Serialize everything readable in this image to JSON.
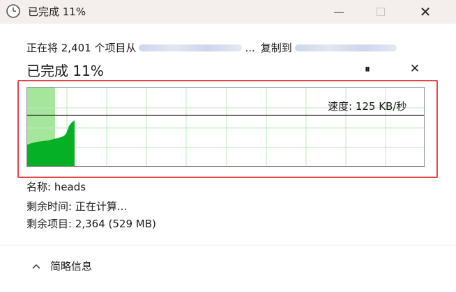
{
  "window": {
    "title": "已完成 11%",
    "title_icon": "clock-icon",
    "minimize_icon": "minimize-icon",
    "maximize_icon": "maximize-icon",
    "close_icon": "close-icon",
    "close_glyph": "✕"
  },
  "copy": {
    "description_prefix": "正在将 2,401 个项目从",
    "ellipsis": "...",
    "to_label": "复制到"
  },
  "progress": {
    "title": "已完成 11%",
    "percent": 11,
    "pause_glyph": "⏸",
    "cancel_glyph": "✕",
    "speed_text": "速度: 125 KB/秒"
  },
  "details": {
    "name": "名称: heads",
    "time_remaining": "剩余时间: 正在计算...",
    "items_remaining": "剩余项目: 2,364 (529 MB)",
    "toggle_label": "简略信息"
  },
  "colors": {
    "titlebar": "#f4eeed",
    "progress_fill": "#a6e69c",
    "speed_area": "#06b025",
    "grid": "#bfe8bf",
    "highlight": "#e2474a"
  }
}
